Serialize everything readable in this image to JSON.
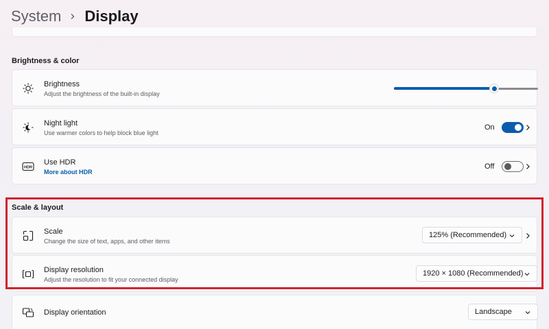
{
  "breadcrumb": {
    "parent": "System",
    "current": "Display"
  },
  "colors": {
    "accent": "#0b5cad",
    "highlight": "#d2222c"
  },
  "sections": {
    "brightness_color": "Brightness & color",
    "scale_layout": "Scale & layout"
  },
  "brightness": {
    "title": "Brightness",
    "subtitle": "Adjust the brightness of the built-in display",
    "icon": "sun-icon",
    "value": 71
  },
  "night_light": {
    "title": "Night light",
    "subtitle": "Use warmer colors to help block blue light",
    "icon": "night-light-icon",
    "state_label": "On",
    "state": true
  },
  "hdr": {
    "title": "Use HDR",
    "link": "More about HDR",
    "icon": "hdr-icon",
    "state_label": "Off",
    "state": false
  },
  "scale": {
    "title": "Scale",
    "subtitle": "Change the size of text, apps, and other items",
    "icon": "scale-icon",
    "selected": "125% (Recommended)"
  },
  "resolution": {
    "title": "Display resolution",
    "subtitle": "Adjust the resolution to fit your connected display",
    "icon": "resolution-icon",
    "selected": "1920 × 1080 (Recommended)"
  },
  "orientation": {
    "title": "Display orientation",
    "icon": "orientation-icon",
    "selected": "Landscape"
  }
}
